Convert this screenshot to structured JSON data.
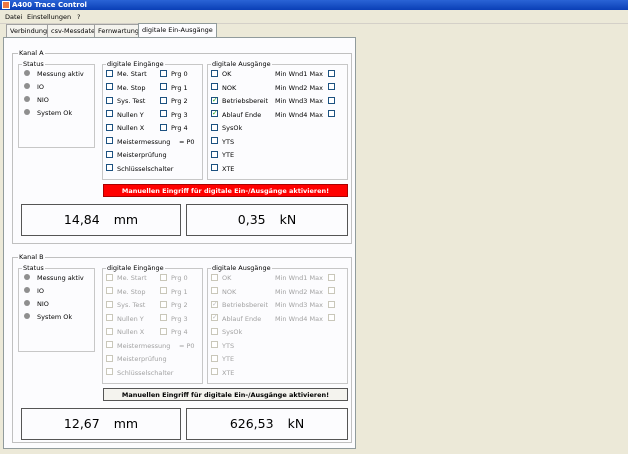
{
  "window": {
    "title": "A400 Trace Control"
  },
  "menu": [
    "Datei",
    "Einstellungen",
    "?"
  ],
  "tabs": [
    "Verbindung",
    "csv-Messdatei",
    "Fernwartung",
    "digitale Ein-Ausgänge"
  ],
  "active_tab": "digitale Ein-Ausgänge",
  "channels": [
    {
      "title": "Kanal A",
      "enabled": true,
      "status": {
        "title": "Status",
        "items": [
          "Messung aktiv",
          "IO",
          "NIO",
          "System Ok"
        ]
      },
      "inputs": {
        "title": "digitale Eingänge",
        "left": [
          {
            "label": "Me. Start",
            "checked": false
          },
          {
            "label": "Me. Stop",
            "checked": false
          },
          {
            "label": "Sys. Test",
            "checked": false
          },
          {
            "label": "Nullen Y",
            "checked": false
          },
          {
            "label": "Nullen X",
            "checked": false
          },
          {
            "label": "Meistermessung",
            "checked": false
          },
          {
            "label": "Meisterprüfung",
            "checked": false
          },
          {
            "label": "Schlüsselschalter",
            "checked": false
          }
        ],
        "right": [
          {
            "label": "Prg 0",
            "checked": false
          },
          {
            "label": "Prg 1",
            "checked": false
          },
          {
            "label": "Prg 2",
            "checked": false
          },
          {
            "label": "Prg 3",
            "checked": false
          },
          {
            "label": "Prg 4",
            "checked": false
          }
        ],
        "p0_label": "= P0"
      },
      "outputs": {
        "title": "digitale Ausgänge",
        "left": [
          {
            "label": "OK",
            "checked": false
          },
          {
            "label": "NOK",
            "checked": false
          },
          {
            "label": "Betriebsbereit",
            "checked": true
          },
          {
            "label": "Ablauf Ende",
            "checked": true
          },
          {
            "label": "SysOk",
            "checked": false
          },
          {
            "label": "YTS",
            "checked": false
          },
          {
            "label": "YTE",
            "checked": false
          },
          {
            "label": "XTE",
            "checked": false
          }
        ],
        "right": [
          {
            "label": "Min Wnd1 Max",
            "checked": false
          },
          {
            "label": "Min Wnd2 Max",
            "checked": false
          },
          {
            "label": "Min Wnd3 Max",
            "checked": false
          },
          {
            "label": "Min Wnd4 Max",
            "checked": false
          }
        ]
      },
      "button": {
        "label": "Manuellen Eingriff für digitale Ein-/Ausgänge aktivieren!",
        "active": true
      },
      "displays": [
        {
          "value": "14,84",
          "unit": "mm"
        },
        {
          "value": "0,35",
          "unit": "kN"
        }
      ]
    },
    {
      "title": "Kanal B",
      "enabled": false,
      "status": {
        "title": "Status",
        "items": [
          "Messung aktiv",
          "IO",
          "NIO",
          "System Ok"
        ]
      },
      "inputs": {
        "title": "digitale Eingänge",
        "left": [
          {
            "label": "Me. Start",
            "checked": false
          },
          {
            "label": "Me. Stop",
            "checked": false
          },
          {
            "label": "Sys. Test",
            "checked": false
          },
          {
            "label": "Nullen Y",
            "checked": false
          },
          {
            "label": "Nullen X",
            "checked": false
          },
          {
            "label": "Meistermessung",
            "checked": false
          },
          {
            "label": "Meisterprüfung",
            "checked": false
          },
          {
            "label": "Schlüsselschalter",
            "checked": false
          }
        ],
        "right": [
          {
            "label": "Prg 0",
            "checked": false
          },
          {
            "label": "Prg 1",
            "checked": false
          },
          {
            "label": "Prg 2",
            "checked": false
          },
          {
            "label": "Prg 3",
            "checked": false
          },
          {
            "label": "Prg 4",
            "checked": false
          }
        ],
        "p0_label": "= P0"
      },
      "outputs": {
        "title": "digitale Ausgänge",
        "left": [
          {
            "label": "OK",
            "checked": false
          },
          {
            "label": "NOK",
            "checked": false
          },
          {
            "label": "Betriebsbereit",
            "checked": true
          },
          {
            "label": "Ablauf Ende",
            "checked": true
          },
          {
            "label": "SysOk",
            "checked": false
          },
          {
            "label": "YTS",
            "checked": false
          },
          {
            "label": "YTE",
            "checked": false
          },
          {
            "label": "XTE",
            "checked": false
          }
        ],
        "right": [
          {
            "label": "Min Wnd1 Max",
            "checked": false
          },
          {
            "label": "Min Wnd2 Max",
            "checked": false
          },
          {
            "label": "Min Wnd3 Max",
            "checked": false
          },
          {
            "label": "Min Wnd4 Max",
            "checked": false
          }
        ]
      },
      "button": {
        "label": "Manuellen Eingriff für digitale Ein-/Ausgänge aktivieren!",
        "active": false
      },
      "displays": [
        {
          "value": "12,67",
          "unit": "mm"
        },
        {
          "value": "626,53",
          "unit": "kN"
        }
      ]
    }
  ]
}
